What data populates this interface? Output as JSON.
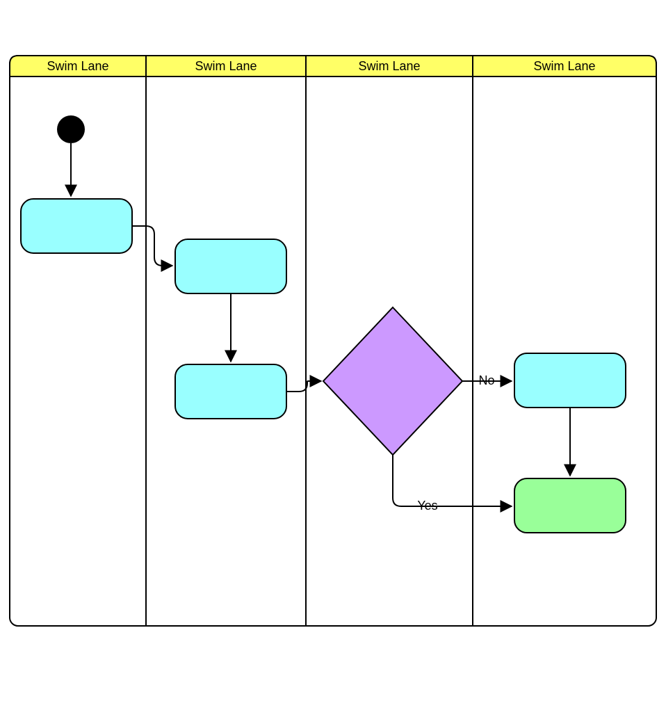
{
  "lanes": {
    "lane1": "Swim Lane",
    "lane2": "Swim Lane",
    "lane3": "Swim Lane",
    "lane4": "Swim Lane"
  },
  "edges": {
    "decision_no": "No",
    "decision_yes": "Yes"
  },
  "colors": {
    "lane_header": "#ffff66",
    "activity": "#99ffff",
    "decision": "#cc99ff",
    "terminal": "#99ff99",
    "start": "#000000"
  }
}
